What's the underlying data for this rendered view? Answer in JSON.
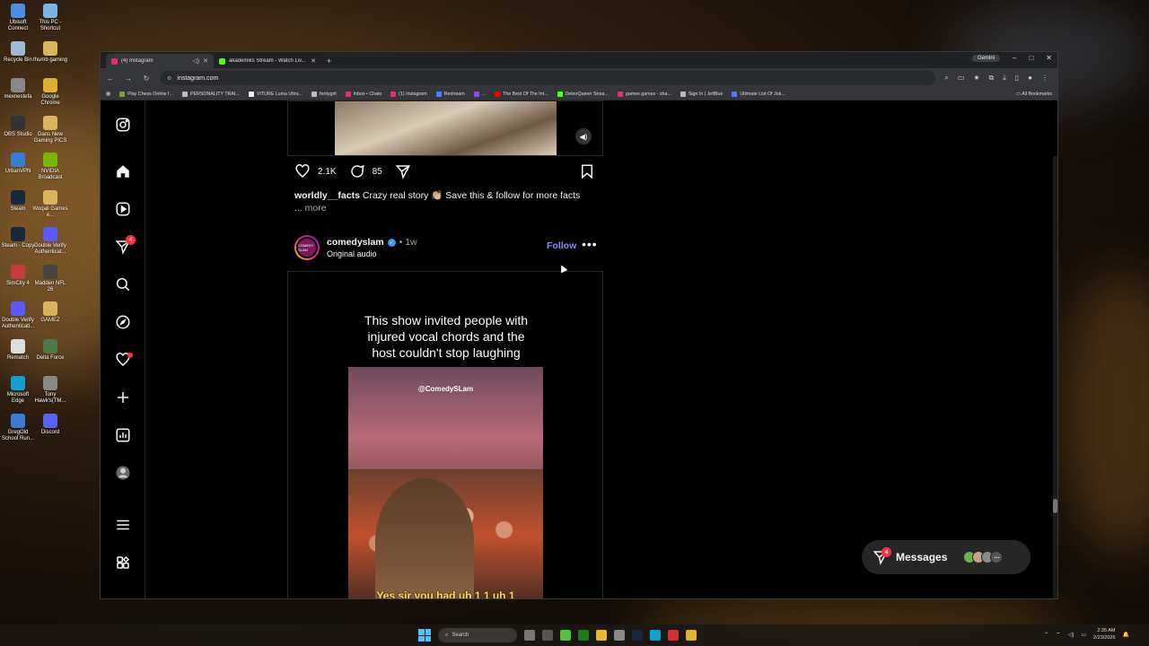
{
  "desktop": {
    "icons": [
      {
        "label": "Ubisoft Connect",
        "color": "#4a8fe0"
      },
      {
        "label": "This PC - Shortcut",
        "color": "#7ab3e8"
      },
      {
        "label": "Recycle Bin",
        "color": "#a0b8d0"
      },
      {
        "label": "thumb gaming",
        "color": "#d9b45a"
      },
      {
        "label": "mexnestefa",
        "color": "#888"
      },
      {
        "label": "Google Chrome",
        "color": "#e0b030"
      },
      {
        "label": "OBS Studio",
        "color": "#333"
      },
      {
        "label": "Dans New Gaming PICS",
        "color": "#d9b45a"
      },
      {
        "label": "UrbanVPN",
        "color": "#3a7bd5"
      },
      {
        "label": "NVIDIA Broadcast",
        "color": "#76b900"
      },
      {
        "label": "Steam",
        "color": "#1b2838"
      },
      {
        "label": "Woqali Games e...",
        "color": "#d9b45a"
      },
      {
        "label": "Steam - Copy",
        "color": "#1b2838"
      },
      {
        "label": "Double Verify Authenticat...",
        "color": "#5a5aff"
      },
      {
        "label": "SimCity 4",
        "color": "#c04040"
      },
      {
        "label": "Madden NFL 26",
        "color": "#444"
      },
      {
        "label": "Double Verify Authenticati...",
        "color": "#5a5aff"
      },
      {
        "label": "GAMEZ",
        "color": "#d9b45a"
      },
      {
        "label": "Rematch",
        "color": "#ddd"
      },
      {
        "label": "Delta Force",
        "color": "#4a7a4a"
      },
      {
        "label": "Microsoft Edge",
        "color": "#0f9fd0"
      },
      {
        "label": "Tony Hawk's(TM...",
        "color": "#888"
      },
      {
        "label": "GregOld School Run...",
        "color": "#3a7bd5"
      },
      {
        "label": "Discord",
        "color": "#5865f2"
      }
    ]
  },
  "browser": {
    "tabs": [
      {
        "label": "(4) Instagram",
        "active": true,
        "favicon_color": "#e1306c"
      },
      {
        "label": "akademiks Stream - Watch Liv...",
        "active": false,
        "favicon_color": "#53fc18"
      }
    ],
    "new_tab": "+",
    "gemini_label": "Gemini",
    "controls": {
      "minimize": "–",
      "maximize": "□",
      "close": "✕"
    },
    "url": "instagram.com",
    "bookmarks": [
      {
        "label": "Play Chess Online f...",
        "color": "#7a9e3a"
      },
      {
        "label": "PERSONALITY TRAI...",
        "color": "#bbb"
      },
      {
        "label": "VITURE Luma Ultra...",
        "color": "#eee"
      },
      {
        "label": "fentygirl",
        "color": "#bbb"
      },
      {
        "label": "Inbox • Chats",
        "color": "#e1306c"
      },
      {
        "label": "(1) Instagram",
        "color": "#e1306c"
      },
      {
        "label": "Restream",
        "color": "#4d7cff"
      },
      {
        "label": "...",
        "color": "#9146ff"
      },
      {
        "label": "The Best Of The Int...",
        "color": "#ff0000"
      },
      {
        "label": "DelenQueen Strea...",
        "color": "#53fc18"
      },
      {
        "label": "games games - sha...",
        "color": "#e1306c"
      },
      {
        "label": "Sign In | JetBlue",
        "color": "#bbb"
      },
      {
        "label": "Ultimate List Of Jok...",
        "color": "#4d7cff"
      }
    ],
    "all_bookmarks": "All Bookmarks"
  },
  "instagram": {
    "nav_badge": "4",
    "prev_post": {
      "likes": "2.1K",
      "comments": "85",
      "caption_user": "worldly__facts",
      "caption_text": " Crazy real story 👏🏼 Save this & follow for more facts",
      "more": "... more"
    },
    "post": {
      "username": "comedyslam",
      "time": "• 1w",
      "audio": "Original audio",
      "follow": "Follow",
      "avatar_text": "COMEDY SLAM",
      "video_title_1": "This show invited people with",
      "video_title_2": "injured vocal chords and the",
      "video_title_3": "host couldn't stop laughing",
      "watermark": "@ComedySLam",
      "subtitle": "Yes sir you had uh 1 1 uh 1"
    },
    "messages": {
      "label": "Messages",
      "badge": "4"
    }
  },
  "taskbar": {
    "search": "Search",
    "time": "2:35 AM",
    "date": "2/23/2026"
  },
  "colors": {
    "accent": "#0095f6",
    "follow": "#8a8fff",
    "notification": "#ff3040"
  }
}
